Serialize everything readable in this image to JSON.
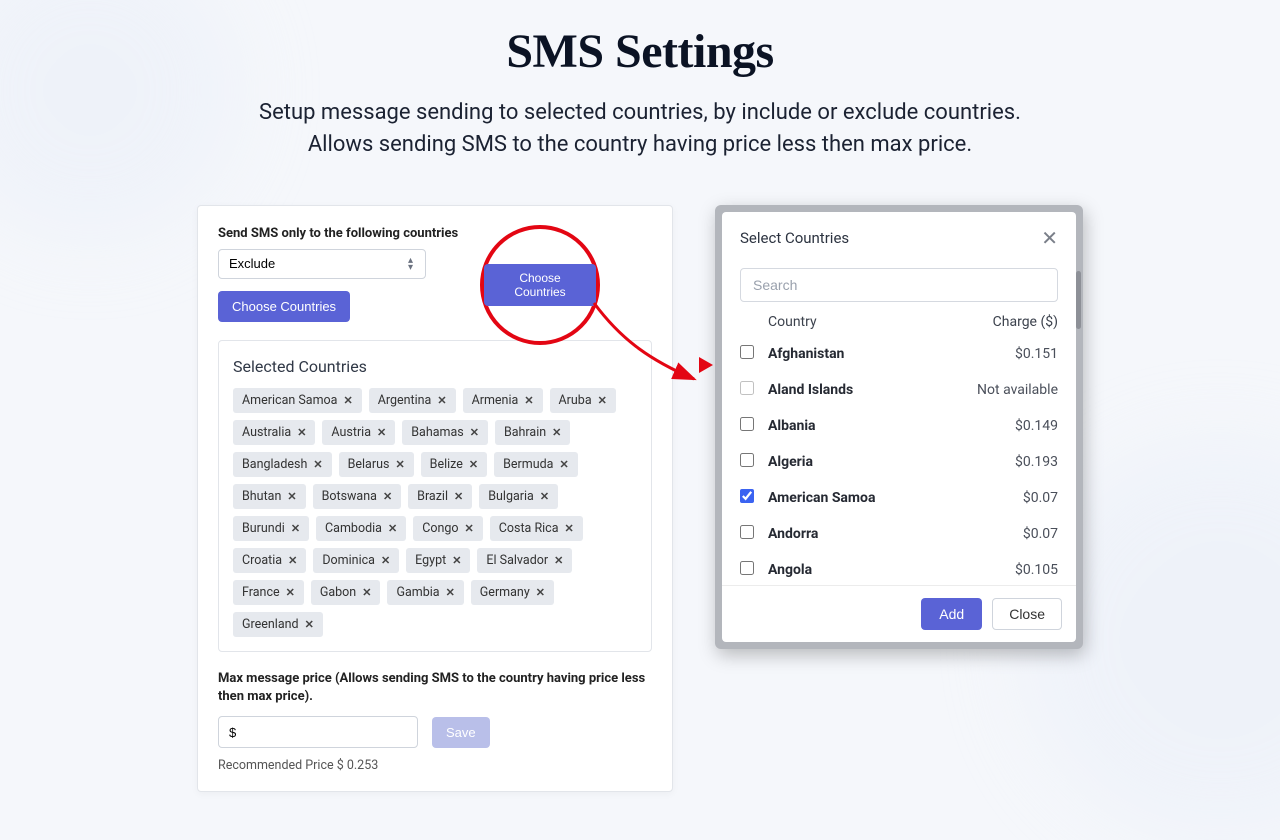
{
  "title": "SMS Settings",
  "subtitle_line1": "Setup message sending to selected countries, by include or exclude countries.",
  "subtitle_line2": "Allows sending SMS to the country having price less then max price.",
  "panel": {
    "scope_label": "Send SMS only to the following countries",
    "scope_value": "Exclude",
    "choose_btn": "Choose Countries",
    "selected_heading": "Selected Countries",
    "selected": [
      "American Samoa",
      "Argentina",
      "Armenia",
      "Aruba",
      "Australia",
      "Austria",
      "Bahamas",
      "Bahrain",
      "Bangladesh",
      "Belarus",
      "Belize",
      "Bermuda",
      "Bhutan",
      "Botswana",
      "Brazil",
      "Bulgaria",
      "Burundi",
      "Cambodia",
      "Congo",
      "Costa Rica",
      "Croatia",
      "Dominica",
      "Egypt",
      "El Salvador",
      "France",
      "Gabon",
      "Gambia",
      "Germany",
      "Greenland"
    ],
    "max_label": "Max message price (Allows sending SMS to the country having price less then max price).",
    "price_value": "$",
    "save_btn": "Save",
    "recommended": "Recommended Price $ 0.253"
  },
  "callout_btn": "Choose Countries",
  "modal": {
    "title": "Select Countries",
    "search_placeholder": "Search",
    "col_country": "Country",
    "col_charge": "Charge ($)",
    "rows": [
      {
        "name": "Afghanistan",
        "charge": "$0.151",
        "checked": false
      },
      {
        "name": "Aland Islands",
        "charge": "Not available",
        "checked": false,
        "disabled": true
      },
      {
        "name": "Albania",
        "charge": "$0.149",
        "checked": false
      },
      {
        "name": "Algeria",
        "charge": "$0.193",
        "checked": false
      },
      {
        "name": "American Samoa",
        "charge": "$0.07",
        "checked": true
      },
      {
        "name": "Andorra",
        "charge": "$0.07",
        "checked": false
      },
      {
        "name": "Angola",
        "charge": "$0.105",
        "checked": false
      }
    ],
    "add_btn": "Add",
    "close_btn": "Close"
  }
}
